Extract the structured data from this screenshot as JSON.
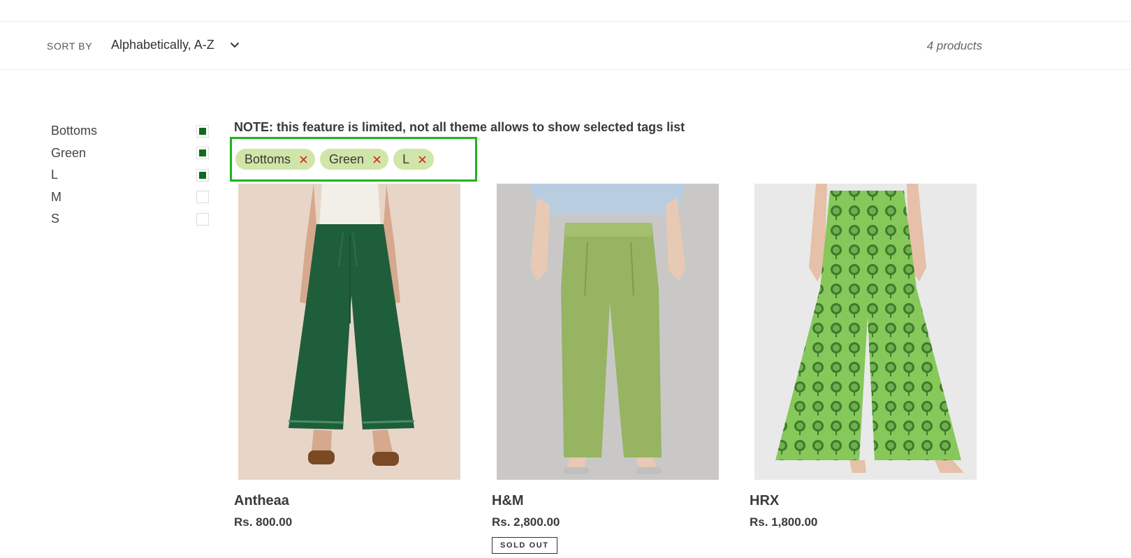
{
  "sortbar": {
    "label": "SORT BY",
    "selected": "Alphabetically, A-Z",
    "product_count": "4 products"
  },
  "filters": [
    {
      "label": "Bottoms",
      "checked": true
    },
    {
      "label": "Green",
      "checked": true
    },
    {
      "label": "L",
      "checked": true
    },
    {
      "label": "M",
      "checked": false
    },
    {
      "label": "S",
      "checked": false
    }
  ],
  "note": "NOTE: this feature is limited, not all theme allows to show selected tags list",
  "selected_tags": [
    {
      "label": "Bottoms",
      "remove_icon": "close-icon"
    },
    {
      "label": "Green",
      "remove_icon": "close-icon"
    },
    {
      "label": "L",
      "remove_icon": "close-icon"
    }
  ],
  "products": [
    {
      "title": "Antheaa",
      "price": "Rs. 800.00",
      "sold_out": false,
      "badge": ""
    },
    {
      "title": "H&M",
      "price": "Rs. 2,800.00",
      "sold_out": true,
      "badge": "SOLD OUT"
    },
    {
      "title": "HRX",
      "price": "Rs. 1,800.00",
      "sold_out": false,
      "badge": ""
    }
  ],
  "colors": {
    "accent_border": "#1fb31f",
    "tag_bg": "#cfe6a8",
    "checkbox_fill": "#0f6b1f",
    "remove_x": "#d62b2b"
  }
}
